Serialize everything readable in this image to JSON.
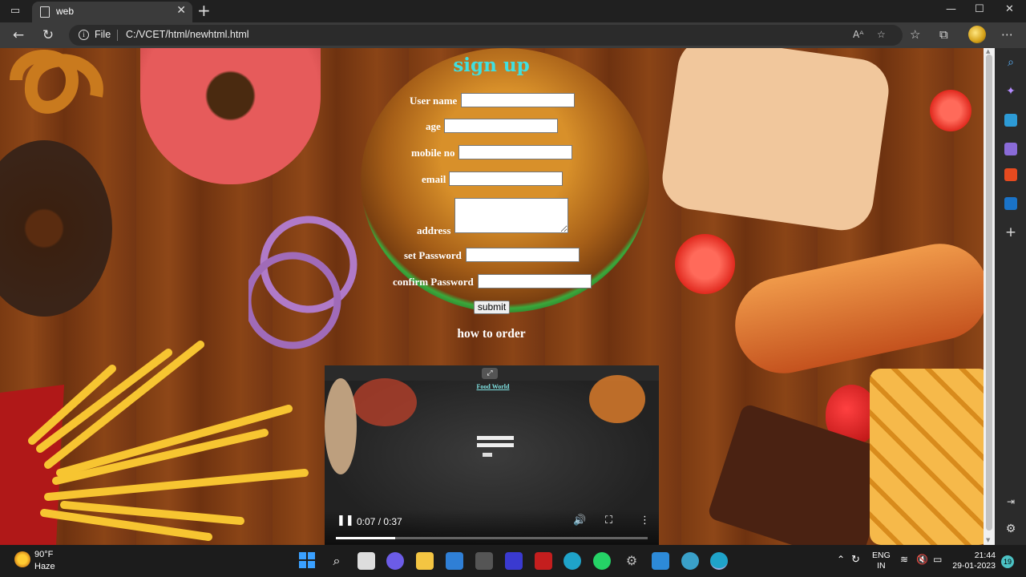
{
  "browser": {
    "tab_title": "web",
    "url_protocol": "File",
    "url": "C:/VCET/html/newhtml.html",
    "colors": {
      "frame": "#202020",
      "toolbar": "#3b3b3b"
    }
  },
  "page": {
    "title": "sign up",
    "fields": [
      {
        "label": "User name",
        "value": ""
      },
      {
        "label": "age",
        "value": ""
      },
      {
        "label": "mobile no",
        "value": ""
      },
      {
        "label": "email",
        "value": ""
      },
      {
        "label": "address",
        "value": ""
      },
      {
        "label": "set Password",
        "value": ""
      },
      {
        "label": "confirm Password",
        "value": ""
      }
    ],
    "submit_label": "submit",
    "how_to_order": "how to order",
    "colors": {
      "title": "#3fe0e0",
      "labels": "#ffffff"
    }
  },
  "video": {
    "inner_title": "Food World",
    "time": "0:07 / 0:37",
    "progress": 0.19,
    "playing": true
  },
  "taskbar": {
    "weather_temp": "90°F",
    "weather_desc": "Haze",
    "lang_top": "ENG",
    "lang_bottom": "IN",
    "clock_time": "21:44",
    "clock_date": "29-01-2023",
    "notification_count": "19"
  }
}
